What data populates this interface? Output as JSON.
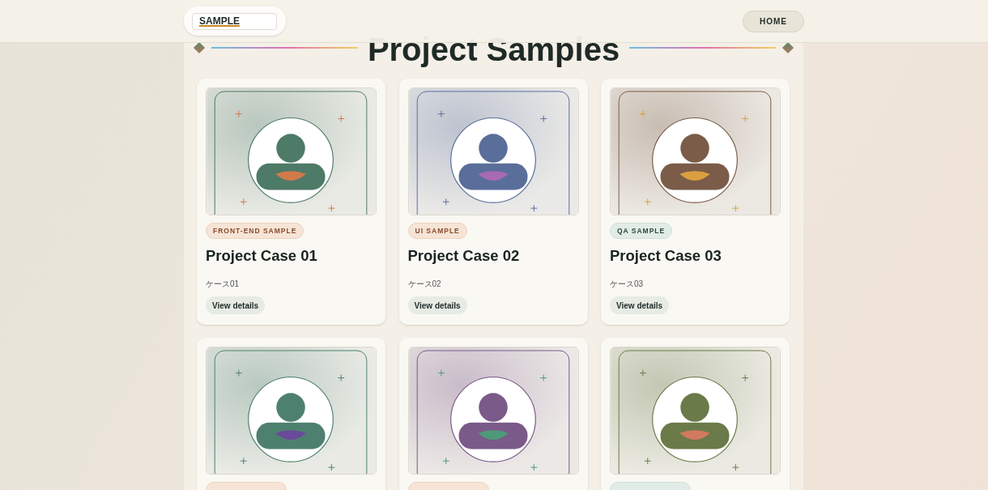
{
  "header": {
    "logo": "SAMPLE",
    "nav": [
      {
        "label": "HOME"
      }
    ]
  },
  "page_title": "Project Samples",
  "cards": [
    {
      "tag": {
        "kind": "front-end",
        "label": "FRONT-END SAMPLE"
      },
      "title": "Project Case 01",
      "subtitle": "ケース01",
      "button": "View details",
      "avatar": {
        "color": "#4e7a68",
        "accent": {
          "color": "#d07a4a"
        }
      }
    },
    {
      "tag": {
        "kind": "ui",
        "label": "UI SAMPLE"
      },
      "title": "Project Case 02",
      "subtitle": "ケース02",
      "button": "View details",
      "avatar": {
        "color": "#5a6e9a",
        "accent": {
          "color": "#a86ab0"
        }
      }
    },
    {
      "tag": {
        "kind": "qa",
        "label": "QA SAMPLE"
      },
      "title": "Project Case 03",
      "subtitle": "ケース03",
      "button": "View details",
      "avatar": {
        "color": "#7a5c48",
        "accent": {
          "color": "#d9a040"
        }
      }
    },
    {
      "tag": {
        "kind": "front-end"
      },
      "avatar": {
        "color": "#4e8070",
        "accent": {
          "color": "#6a4a9a"
        }
      }
    },
    {
      "tag": {
        "kind": "ui"
      },
      "avatar": {
        "color": "#7a5a88",
        "accent": {
          "color": "#4e9a78"
        }
      }
    },
    {
      "tag": {
        "kind": "qa"
      },
      "avatar": {
        "color": "#6a7a48",
        "accent": {
          "color": "#d07a60"
        }
      }
    }
  ]
}
